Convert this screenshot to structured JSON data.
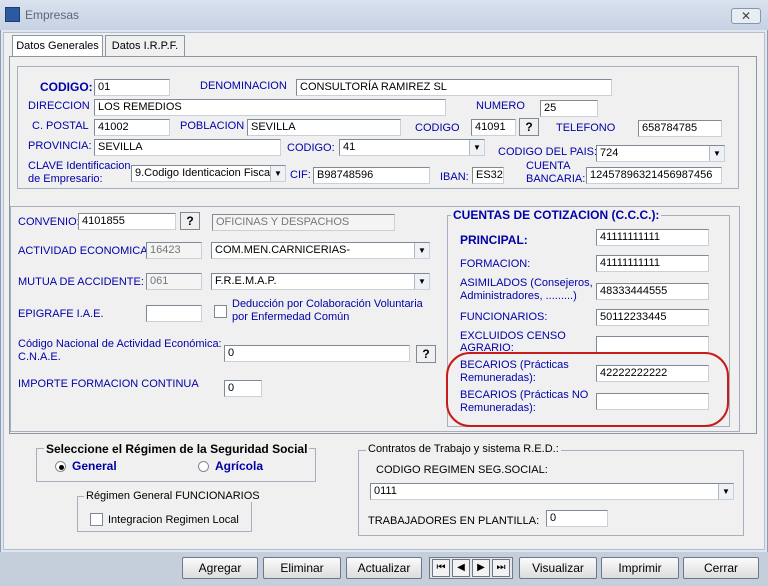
{
  "window": {
    "title": "Empresas",
    "close": "✕"
  },
  "tabs": [
    "Datos Generales",
    "Datos I.R.P.F."
  ],
  "company": {
    "codigo_label": "CODIGO:",
    "codigo": "01",
    "denominacion_label": "DENOMINACION",
    "denominacion": "CONSULTORÍA RAMIREZ SL",
    "direccion_label": "DIRECCION",
    "direccion": "LOS REMEDIOS",
    "numero_label": "NUMERO",
    "numero": "25",
    "cpostal_label": "C. POSTAL",
    "cpostal": "41002",
    "poblacion_label": "POBLACION",
    "poblacion": "SEVILLA",
    "codigo2_label": "CODIGO",
    "codigo2": "41091",
    "help": "?",
    "telefono_label": "TELEFONO",
    "telefono": "658784785",
    "provincia_label": "PROVINCIA:",
    "provincia": "SEVILLA",
    "codigo3_label": "CODIGO:",
    "codigo3": "41",
    "codigo_pais_label": "CODIGO DEL PAIS:",
    "codigo_pais": "724",
    "clave_label_1": "CLAVE Identificacion",
    "clave_label_2": "de Empresario:",
    "clave": "9.Codigo Identicacion Fiscal",
    "cif_label": "CIF:",
    "cif": "B98748596",
    "iban_label": "IBAN:",
    "iban": "ES32",
    "cuenta_label_1": "CUENTA",
    "cuenta_label_2": "BANCARIA:",
    "cuenta": "12457896321456987456"
  },
  "activity": {
    "convenio_label": "CONVENIO:",
    "convenio": "4101855",
    "convenio_desc": "OFICINAS Y DESPACHOS",
    "actividad_label": "ACTIVIDAD ECONOMICA:",
    "actividad_code": "16423",
    "actividad_desc": "COM.MEN.CARNICERIAS-",
    "mutua_label": "MUTUA DE ACCIDENTE:",
    "mutua_code": "061",
    "mutua_desc": "F.R.E.M.A.P.",
    "epigrafe_label": "EPIGRAFE I.A.E.",
    "epigrafe": "",
    "deduccion_label_1": "Deducción por Colaboración Voluntaria",
    "deduccion_label_2": "por Enfermedad Común",
    "cnae_label_1": "Código Nacional de Actividad Económica:",
    "cnae_label_2": "C.N.A.E.",
    "cnae": "0",
    "formacion_label": "IMPORTE FORMACION CONTINUA",
    "formacion": "0"
  },
  "ccc": {
    "title": "CUENTAS DE COTIZACION (C.C.C.):",
    "principal_label": "PRINCIPAL:",
    "principal": "41111111111",
    "formacion_label": "FORMACION:",
    "formacion": "41111111111",
    "asimilados_label_1": "ASIMILADOS (Consejeros,",
    "asimilados_label_2": "Administradores, .........)",
    "asimilados": "48333444555",
    "funcionarios_label": "FUNCIONARIOS:",
    "funcionarios": "50112233445",
    "excluidos_label_1": "EXCLUIDOS CENSO",
    "excluidos_label_2": "AGRARIO:",
    "excluidos": "",
    "becarios_label_1": "BECARIOS (Prácticas",
    "becarios_label_2": "Remuneradas):",
    "becarios": "42222222222",
    "becarios_no_label_1": "BECARIOS (Prácticas NO",
    "becarios_no_label_2": "Remuneradas):",
    "becarios_no": ""
  },
  "regimen": {
    "title": "Seleccione el Régimen de la Seguridad Social",
    "general": "General",
    "agricola": "Agrícola",
    "funcionarios_title": "Régimen General FUNCIONARIOS",
    "integracion": "Integracion Regimen Local"
  },
  "contratos": {
    "title": "Contratos de Trabajo y sistema R.E.D.:",
    "codigo_regimen_label": "CODIGO REGIMEN SEG.SOCIAL:",
    "codigo_regimen": "0111",
    "trabajadores_label": "TRABAJADORES EN PLANTILLA:",
    "trabajadores": "0"
  },
  "buttons": {
    "agregar": "Agregar",
    "eliminar": "Eliminar",
    "actualizar": "Actualizar",
    "visualizar": "Visualizar",
    "imprimir": "Imprimir",
    "cerrar": "Cerrar",
    "nav_first": "⏮",
    "nav_prev": "◀",
    "nav_next": "▶",
    "nav_last": "⏭"
  },
  "colors": {
    "label": "#0000a8",
    "highlight": "#c71a1a"
  }
}
